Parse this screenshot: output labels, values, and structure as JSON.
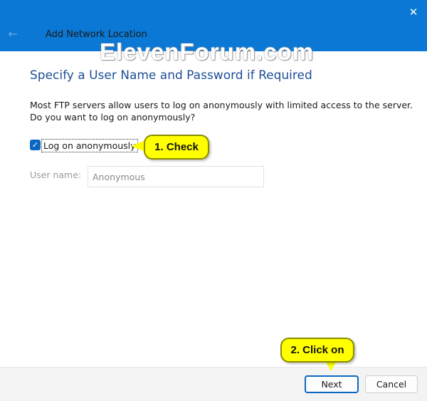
{
  "window": {
    "title": "Add Network Location",
    "close_glyph": "✕",
    "back_glyph": "←"
  },
  "watermark": "ElevenForum.com",
  "heading": "Specify a User Name and Password if Required",
  "description": "Most FTP servers allow users to log on anonymously with limited access to the server.  Do you want to log on anonymously?",
  "anonymous": {
    "label": "Log on anonymously",
    "checked": true,
    "check_glyph": "✓"
  },
  "username": {
    "label": "User name:",
    "value": "Anonymous"
  },
  "callouts": {
    "check": "1. Check",
    "click": "2. Click on"
  },
  "buttons": {
    "next": "Next",
    "cancel": "Cancel"
  },
  "colors": {
    "titlebar": "#0a78d4",
    "heading": "#1e4e96",
    "accent": "#0a67c2",
    "callout": "#ffff00"
  },
  "icons": {
    "back": "back-arrow-icon",
    "close": "close-icon",
    "checkbox": "checkmark-icon"
  }
}
